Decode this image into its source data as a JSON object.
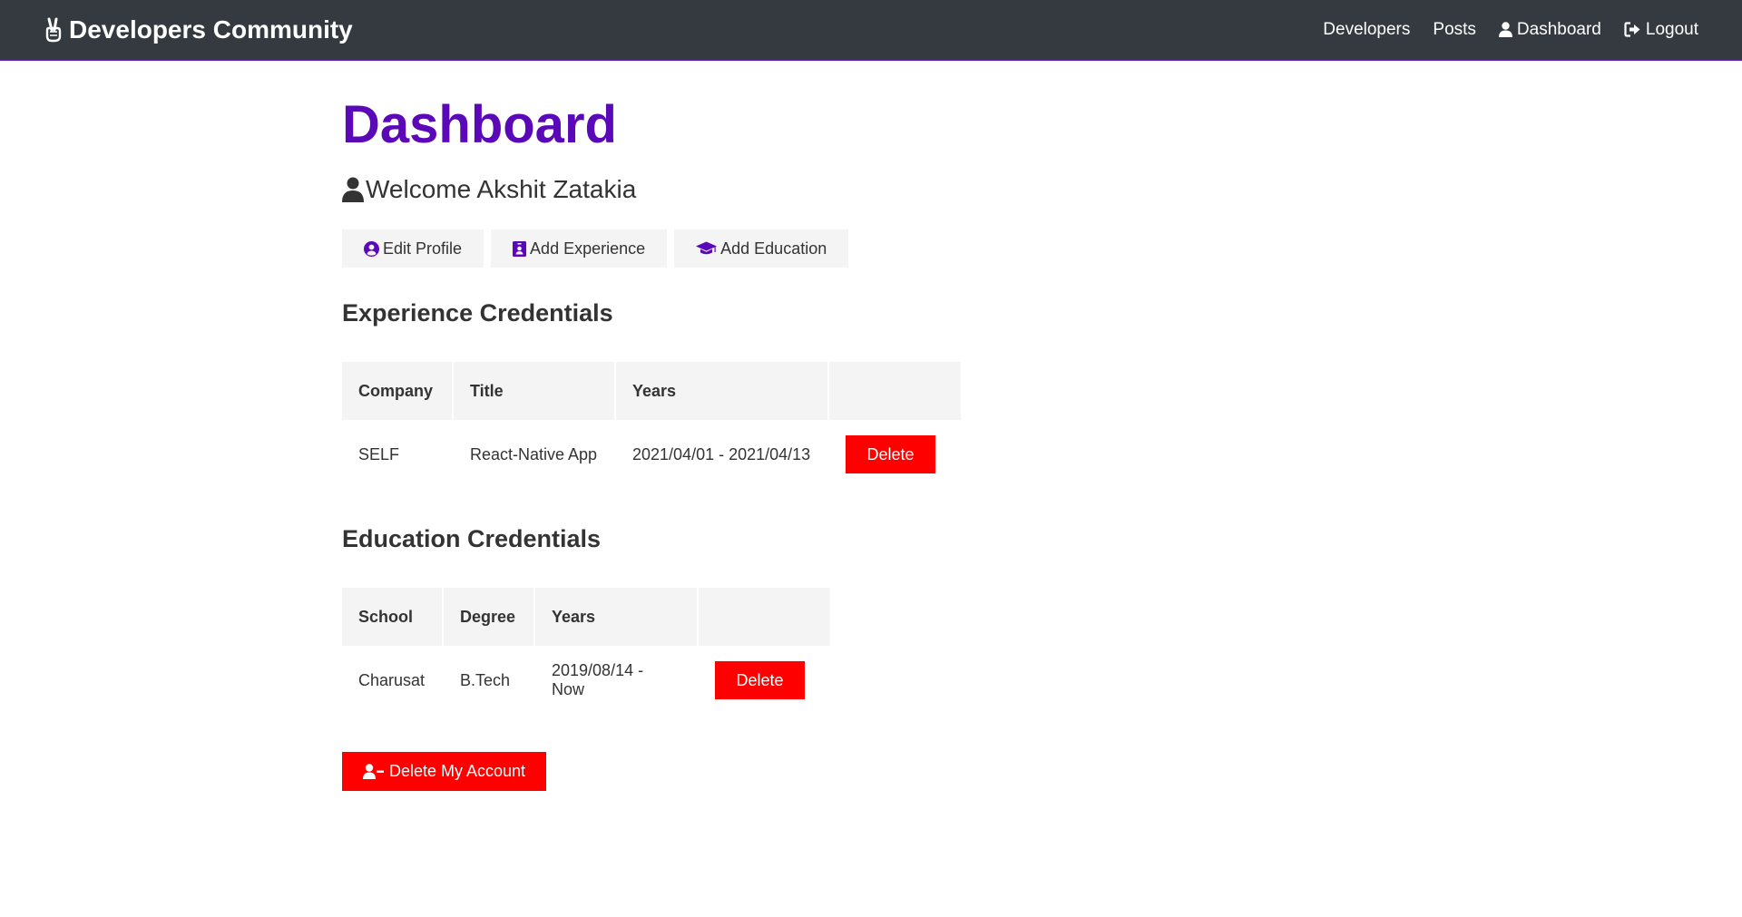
{
  "navbar": {
    "brand_icon": "hand-peace-icon",
    "brand": "Developers Community",
    "links": [
      {
        "label": "Developers",
        "icon": ""
      },
      {
        "label": "Posts",
        "icon": ""
      },
      {
        "label": "Dashboard",
        "icon": "user-icon"
      },
      {
        "label": "Logout",
        "icon": "sign-out-icon"
      }
    ],
    "background_color": "#343a40",
    "border_color": "#5b1aa8"
  },
  "page": {
    "title": "Dashboard",
    "title_color": "#5b08b8",
    "welcome": "Welcome Akshit Zatakia",
    "welcome_icon": "user-icon"
  },
  "actions": {
    "edit_profile": {
      "label": "Edit Profile",
      "icon": "user-circle-icon"
    },
    "add_experience": {
      "label": "Add Experience",
      "icon": "id-badge-icon"
    },
    "add_education": {
      "label": "Add Education",
      "icon": "graduation-cap-icon"
    },
    "icon_color": "#5b08b8"
  },
  "experience": {
    "title": "Experience Credentials",
    "headers": [
      "Company",
      "Title",
      "Years",
      ""
    ],
    "rows": [
      {
        "company": "SELF",
        "title": "React-Native App",
        "years": "2021/04/01 - 2021/04/13",
        "delete_label": "Delete"
      }
    ]
  },
  "education": {
    "title": "Education Credentials",
    "headers": [
      "School",
      "Degree",
      "Years",
      ""
    ],
    "rows": [
      {
        "school": "Charusat",
        "degree": "B.Tech",
        "years": "2019/08/14 - Now",
        "delete_label": "Delete"
      }
    ]
  },
  "delete_account": {
    "label": "Delete My Account",
    "icon": "user-minus-icon",
    "color": "#ff0000"
  }
}
